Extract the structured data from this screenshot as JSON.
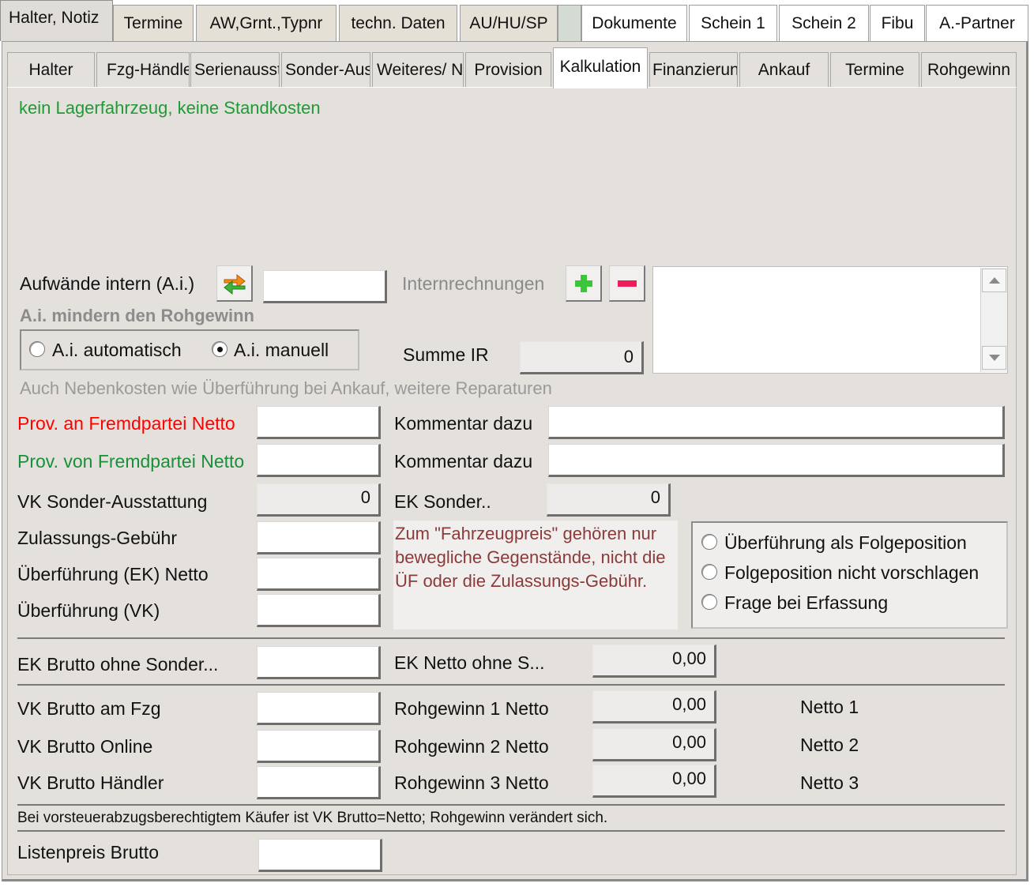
{
  "top_tabs": [
    {
      "label": "Halter, Notiz"
    },
    {
      "label": "Termine"
    },
    {
      "label": "AW,Grnt.,Typnr"
    },
    {
      "label": "techn. Daten"
    },
    {
      "label": "AU/HU/SP"
    },
    {
      "label": ""
    },
    {
      "label": "Dokumente"
    },
    {
      "label": "Schein 1"
    },
    {
      "label": "Schein 2"
    },
    {
      "label": "Fibu"
    },
    {
      "label": "A.-Partner"
    }
  ],
  "sub_tabs": [
    {
      "label": "Halter"
    },
    {
      "label": "Fzg-Händler"
    },
    {
      "label": "Serienausstattung"
    },
    {
      "label": "Sonder-Ausstattung"
    },
    {
      "label": "Weiteres/ Notiz"
    },
    {
      "label": "Provision"
    },
    {
      "label": "Kalkulation"
    },
    {
      "label": "Finanzierung"
    },
    {
      "label": "Ankauf"
    },
    {
      "label": "Termine"
    },
    {
      "label": "Rohgewinn"
    }
  ],
  "notice": "kein Lagerfahrzeug, keine Standkosten",
  "ai": {
    "label": "Aufwände intern (A.i.)",
    "value": "",
    "hint": "A.i. mindern den Rohgewinn",
    "radio_auto": "A.i. automatisch",
    "radio_manual": "A.i. manuell",
    "selected": "manual",
    "note": "Auch Nebenkosten wie Überführung bei Ankauf, weitere Reparaturen"
  },
  "internal": {
    "label": "Internrechnungen",
    "sum_label": "Summe IR",
    "sum_value": "0"
  },
  "provisions": {
    "to_label": "Prov. an Fremdpartei Netto",
    "to_value": "",
    "from_label": "Prov. von Fremdpartei Netto",
    "from_value": "",
    "comment_label": "Kommentar dazu",
    "comment_to": "",
    "comment_from": ""
  },
  "fields": {
    "vk_sonder_label": "VK Sonder-Ausstattung",
    "vk_sonder_value": "0",
    "ek_sonder_label": "EK Sonder..",
    "ek_sonder_value": "0",
    "zulassung_label": "Zulassungs-Gebühr",
    "ueberf_ek_label": "Überführung (EK) Netto",
    "ueberf_vk_label": "Überführung (VK)"
  },
  "price_note": "Zum \"Fahrzeugpreis\" gehören nur bewegliche Gegenstände, nicht die ÜF oder die Zulassungs-Gebühr.",
  "options": {
    "opt1": "Überführung als Folgeposition",
    "opt2": "Folgeposition nicht vorschlagen",
    "opt3": "Frage bei Erfassung"
  },
  "ek": {
    "brutto_label": "EK Brutto ohne Sonder...",
    "netto_label": "EK Netto ohne S...",
    "netto_value": "0,00"
  },
  "vk": {
    "fzg_label": "VK Brutto am Fzg",
    "online_label": "VK Brutto Online",
    "haendler_label": "VK Brutto Händler",
    "rg1_label": "Rohgewinn 1 Netto",
    "rg2_label": "Rohgewinn 2 Netto",
    "rg3_label": "Rohgewinn 3 Netto",
    "rg1_value": "0,00",
    "rg2_value": "0,00",
    "rg3_value": "0,00",
    "n1": "Netto 1",
    "n2": "Netto 2",
    "n3": "Netto 3"
  },
  "footer_note": "Bei vorsteuerabzugsberechtigtem Käufer ist VK Brutto=Netto; Rohgewinn verändert sich.",
  "listenpreis_label": "Listenpreis Brutto",
  "colors": {
    "panel_bg": "#e4e1dd",
    "notice_green": "#1f9a36",
    "prov_red": "#ff0000",
    "note_brown": "#8b3a3a"
  }
}
